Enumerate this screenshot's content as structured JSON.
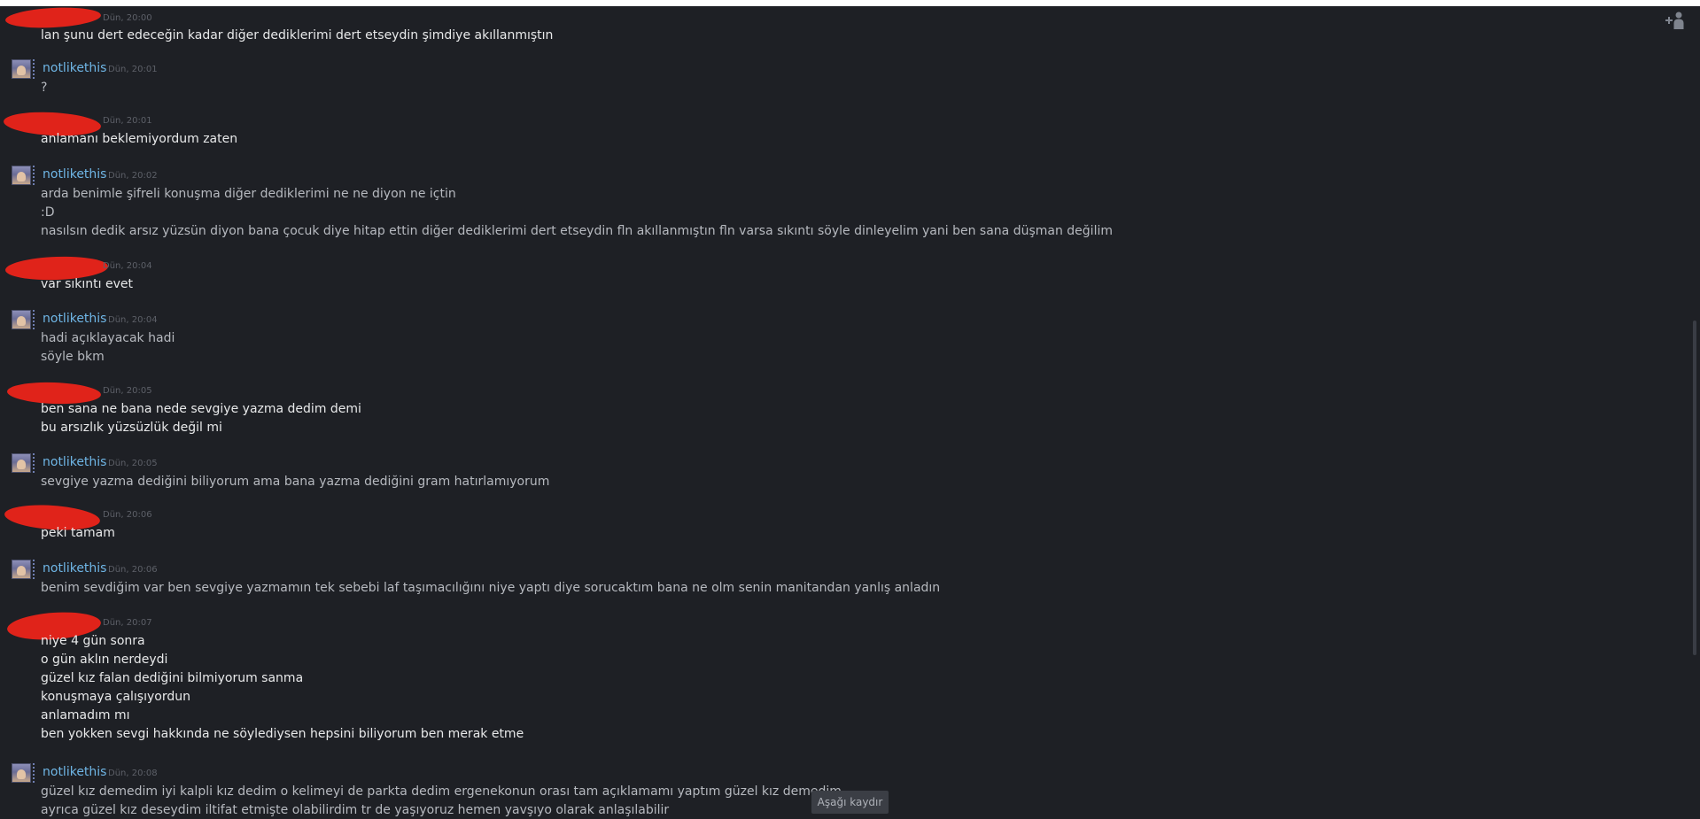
{
  "messages": [
    {
      "sender": "",
      "time": "Dün, 20:00",
      "lines": [
        "lan şunu dert edeceğin kadar diğer dediklerimi dert etseydin şimdiye akıllanmıştın"
      ]
    },
    {
      "sender": "notlikethis",
      "time": "Dün, 20:01",
      "lines": [
        "?"
      ]
    },
    {
      "sender": "",
      "time": "Dün, 20:01",
      "lines": [
        "anlamanı beklemiyordum zaten"
      ]
    },
    {
      "sender": "notlikethis",
      "time": "Dün, 20:02",
      "lines": [
        "arda benimle şifreli konuşma diğer dediklerimi ne ne diyon ne içtin",
        ":D",
        "nasılsın dedik arsız yüzsün diyon bana çocuk diye hitap ettin diğer dediklerimi dert etseydin fln akıllanmıştın fln varsa sıkıntı söyle dinleyelim yani ben sana düşman değilim"
      ]
    },
    {
      "sender": "",
      "time": "Dün, 20:04",
      "lines": [
        "var sıkıntı evet"
      ]
    },
    {
      "sender": "notlikethis",
      "time": "Dün, 20:04",
      "lines": [
        "hadi açıklayacak hadi",
        "söyle bkm"
      ]
    },
    {
      "sender": "",
      "time": "Dün, 20:05",
      "lines": [
        "ben sana ne bana nede sevgiye yazma dedim demi",
        "bu arsızlık yüzsüzlük değil mi"
      ]
    },
    {
      "sender": "notlikethis",
      "time": "Dün, 20:05",
      "lines": [
        "sevgiye yazma dediğini biliyorum ama bana yazma dediğini gram hatırlamıyorum"
      ]
    },
    {
      "sender": "",
      "time": "Dün, 20:06",
      "lines": [
        "peki tamam"
      ]
    },
    {
      "sender": "notlikethis",
      "time": "Dün, 20:06",
      "lines": [
        "benim sevdiğim var ben sevgiye yazmamın tek sebebi laf taşımacılığını niye yaptı diye sorucaktım bana ne olm senin manitandan yanlış anladın"
      ]
    },
    {
      "sender": "",
      "time": "Dün, 20:07",
      "lines": [
        "niye 4 gün sonra",
        "o gün aklın nerdeydi",
        "güzel kız falan dediğini bilmiyorum sanma",
        "konuşmaya çalışıyordun",
        "anlamadım mı",
        "ben yokken sevgi hakkında ne söylediysen hepsini biliyorum ben merak etme"
      ]
    },
    {
      "sender": "notlikethis",
      "time": "Dün, 20:08",
      "lines": [
        "güzel kız demedim iyi kalpli kız dedim o kelimeyi de parkta dedim ergenekonun orası tam açıklamamı yaptım güzel kız demedim",
        "ayrıca güzel kız deseydim iltifat etmişte olabilirdim tr de yaşıyoruz hemen yavşıyo olarak anlaşılabilir"
      ]
    }
  ],
  "scroll_down_label": "Aşağı kaydır",
  "icons": {
    "add_friend": "add-friend-icon",
    "avatar": "avatar-icon"
  },
  "colors": {
    "background": "#1e2025",
    "sender_name": "#6fb6e6",
    "redaction": "#e0231a"
  }
}
